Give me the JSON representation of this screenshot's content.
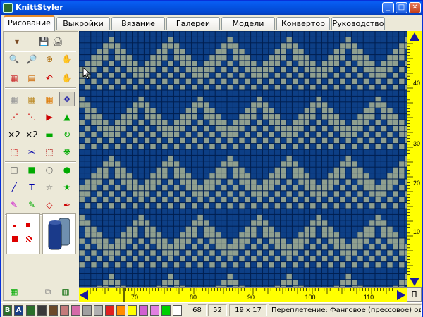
{
  "window": {
    "title": "KnittStyler",
    "min_glyph": "_",
    "max_glyph": "□",
    "close_glyph": "✕"
  },
  "tabs": [
    {
      "label": "Рисование",
      "active": true
    },
    {
      "label": "Выкройки"
    },
    {
      "label": "Вязание"
    },
    {
      "label": "Галереи"
    },
    {
      "label": "Модели"
    },
    {
      "label": "Конвертор"
    },
    {
      "label": "Руководство"
    }
  ],
  "toolbar_icons": [
    "shapes-dropdown-icon",
    "save-icon",
    "printer-icon",
    "zoom-in-icon",
    "zoom-out-icon",
    "zoom-icon",
    "hand-pan-icon",
    "pattern-grid-icon",
    "sheet-icon",
    "undo-icon",
    "glove-icon",
    "grid-empty-icon",
    "grid-color-icon",
    "grid-fill-icon",
    "move-crosshair-icon",
    "symmetry-1-icon",
    "symmetry-2-icon",
    "arrow-right-icon",
    "tree-icon",
    "x2-icon",
    "x2-rows-icon",
    "table-icon",
    "rotate-icon",
    "select-rect-icon",
    "scissors-icon",
    "flip-select-icon",
    "motif-icon",
    "rect-icon",
    "filled-rect-icon",
    "ellipse-icon",
    "filled-ellipse-icon",
    "line-icon",
    "text-icon",
    "star-outline-icon",
    "star-filled-icon",
    "brush-icon",
    "pencil-paint-icon",
    "eraser-icon",
    "eyedropper-icon"
  ],
  "bottom_tools": [
    "green-grid-icon",
    "binoculars-icon",
    "palette-stack-icon"
  ],
  "canvas": {
    "background_color": "#0d3f86",
    "pattern_color": "#8f9f8f",
    "grid_line_color": "#001e4f"
  },
  "ruler_v": {
    "labels": [
      "40",
      "30",
      "20",
      "10"
    ]
  },
  "ruler_h": {
    "labels": [
      "70",
      "80",
      "90",
      "100",
      "110"
    ]
  },
  "ruler_color": "#ffff00",
  "p_button": "П",
  "palette": {
    "b_label": "B",
    "a_label": "A",
    "colors": [
      "#2a6e2a",
      "#3a3a3a",
      "#6b4a2a",
      "#c47b7b",
      "#d46aa8",
      "#a0a0a0",
      "#b0b0b0",
      "#e02020",
      "#ff8c00",
      "#ffff00",
      "#d060d0",
      "#e080e0",
      "#00d000",
      "#ffffff"
    ]
  },
  "status": {
    "val1": "68",
    "val2": "52",
    "size": "19 x 17",
    "weave": "Переплетение: Фанговое (прессовое) однофонтурное"
  }
}
